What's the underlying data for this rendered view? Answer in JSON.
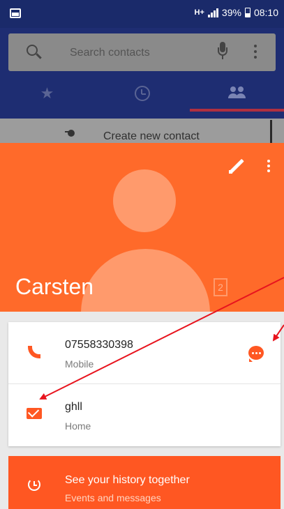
{
  "status_bar": {
    "network": "H+",
    "battery_percent": "39%",
    "time": "08:10"
  },
  "search": {
    "placeholder": "Search contacts"
  },
  "contacts_list": {
    "create_label": "Create new contact"
  },
  "contact": {
    "name": "Carsten",
    "badge": "2",
    "phone": {
      "number": "07558330398",
      "type": "Mobile"
    },
    "email": {
      "address": "ghll",
      "type": "Home"
    }
  },
  "history": {
    "title": "See your history together",
    "subtitle": "Events and messages"
  },
  "colors": {
    "accent": "#ff5722",
    "header": "#ff6a2a",
    "app_bar": "#1e2d72",
    "annotation_arrow": "#e8141e"
  }
}
